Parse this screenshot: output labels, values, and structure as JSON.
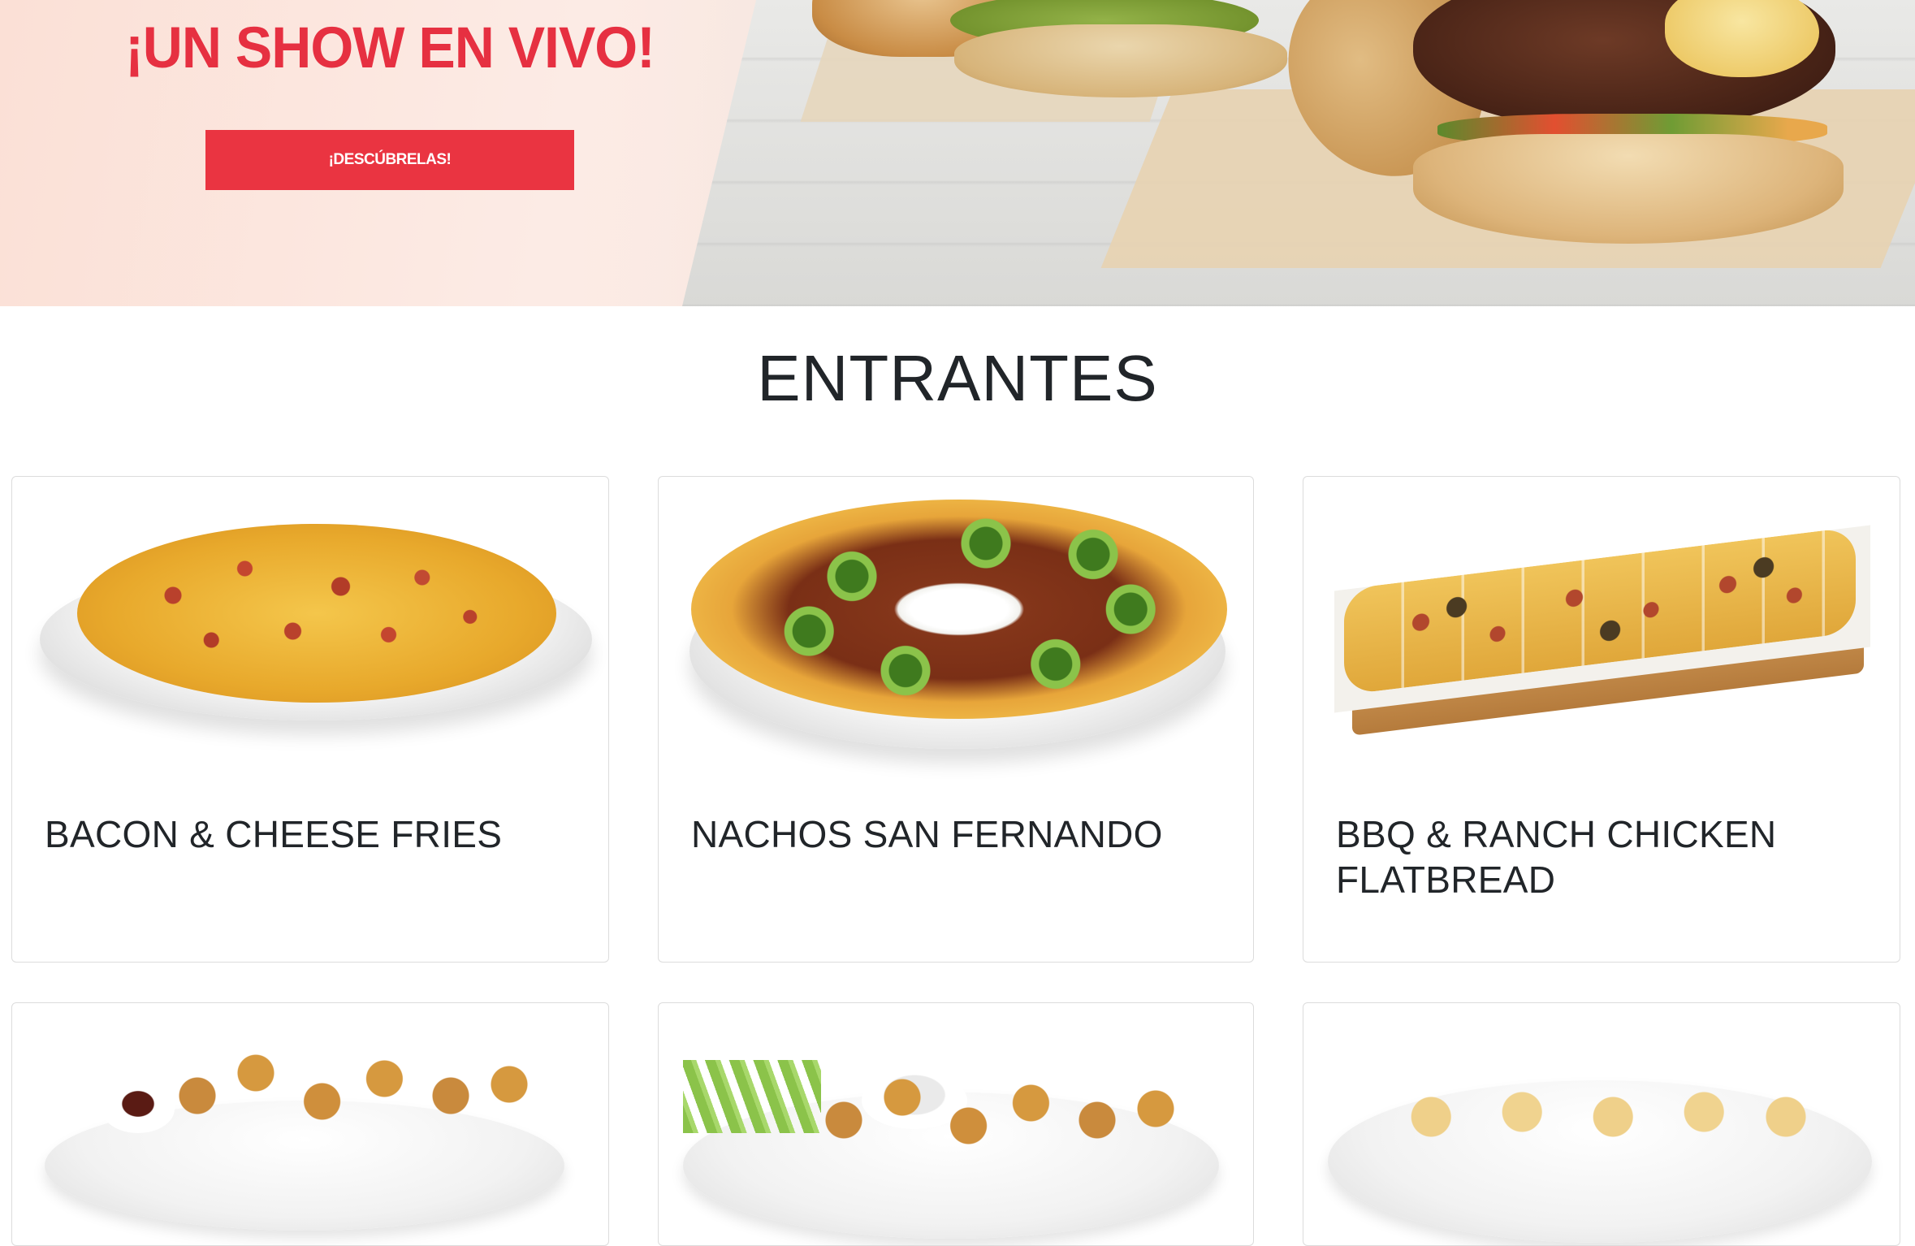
{
  "hero": {
    "title": "¡UN SHOW EN VIVO!",
    "cta_label": "¡DESCÚBRELAS!",
    "accent_color": "#ea3441"
  },
  "section": {
    "title": "ENTRANTES"
  },
  "cards": [
    {
      "title": "BACON & CHEESE FRIES",
      "image": "bacon-cheese-fries-photo"
    },
    {
      "title": "NACHOS SAN FERNANDO",
      "image": "nachos-photo"
    },
    {
      "title": "BBQ & RANCH CHICKEN FLATBREAD",
      "image": "flatbread-photo"
    },
    {
      "title": "",
      "image": "sampler-platter-photo"
    },
    {
      "title": "",
      "image": "chicken-wings-photo"
    },
    {
      "title": "",
      "image": "appetizer-plate-photo"
    }
  ]
}
